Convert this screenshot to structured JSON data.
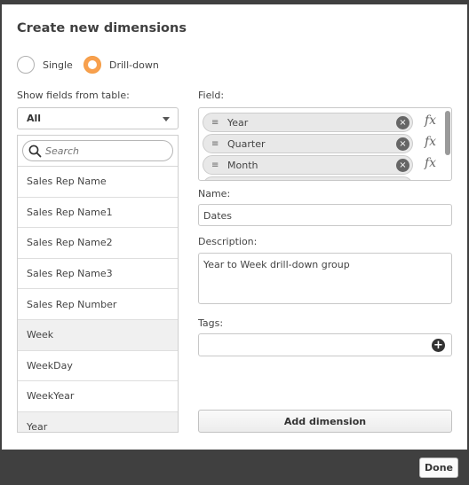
{
  "dialog": {
    "title": "Create new dimensions",
    "mode_options": [
      {
        "label": "Single",
        "selected": false
      },
      {
        "label": "Drill-down",
        "selected": true
      }
    ]
  },
  "left": {
    "table_label": "Show fields from table:",
    "table_select_value": "All",
    "search_placeholder": "Search",
    "fields": [
      {
        "label": "Sales Rep Name",
        "in_use": false
      },
      {
        "label": "Sales Rep Name1",
        "in_use": false
      },
      {
        "label": "Sales Rep Name2",
        "in_use": false
      },
      {
        "label": "Sales Rep Name3",
        "in_use": false
      },
      {
        "label": "Sales Rep Number",
        "in_use": false
      },
      {
        "label": "Week",
        "in_use": true
      },
      {
        "label": "WeekDay",
        "in_use": false
      },
      {
        "label": "WeekYear",
        "in_use": false
      },
      {
        "label": "Year",
        "in_use": true
      }
    ]
  },
  "right": {
    "field_label": "Field:",
    "dimension_fields": [
      {
        "name": "Year",
        "drag_icon": "≡",
        "remove_icon": "×",
        "fx_icon": "fx"
      },
      {
        "name": "Quarter",
        "drag_icon": "≡",
        "remove_icon": "×",
        "fx_icon": "fx"
      },
      {
        "name": "Month",
        "drag_icon": "≡",
        "remove_icon": "×",
        "fx_icon": "fx"
      }
    ],
    "name_label": "Name:",
    "name_value": "Dates",
    "description_label": "Description:",
    "description_value": "Year to Week drill-down group",
    "tags_label": "Tags:",
    "tags_add_icon": "+",
    "add_dimension_label": "Add dimension"
  },
  "footer": {
    "done_label": "Done"
  },
  "colors": {
    "accent": "#f8a04e",
    "frame": "#404040",
    "used_row": "#f0f0f0"
  }
}
